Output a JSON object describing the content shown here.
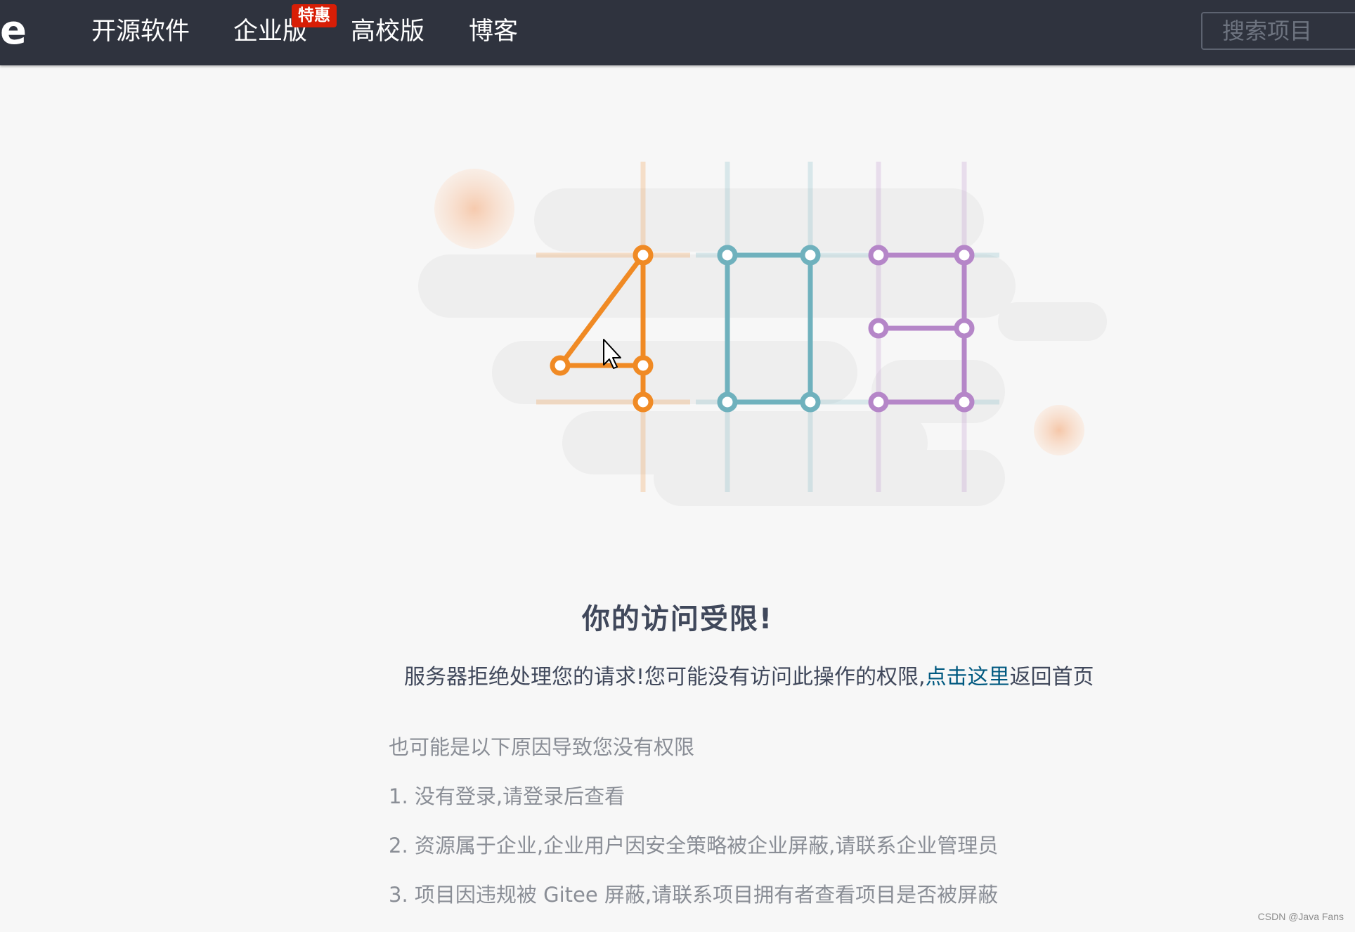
{
  "navbar": {
    "logo_letter": "e",
    "items": [
      {
        "label": "开源软件"
      },
      {
        "label": "企业版",
        "badge": "特惠"
      },
      {
        "label": "高校版"
      },
      {
        "label": "博客"
      }
    ],
    "search_placeholder": "搜索项目"
  },
  "illustration": {
    "digits": "403",
    "colors": {
      "four": "#f08a24",
      "zero": "#6fb1bd",
      "three": "#b586c8",
      "orb": "#f6c8a6"
    },
    "icons": [
      "mouse-cursor-icon"
    ]
  },
  "content": {
    "headline": "你的访问受限!",
    "desc_prefix": "服务器拒绝处理您的请求!您可能没有访问此操作的权限,",
    "desc_link": "点击这里",
    "desc_suffix": "返回首页",
    "reasons_title": "也可能是以下原因导致您没有权限",
    "reasons": [
      "1. 没有登录,请登录后查看",
      "2. 资源属于企业,企业用户因安全策略被企业屏蔽,请联系企业管理员",
      "3. 项目因违规被 Gitee 屏蔽,请联系项目拥有者查看项目是否被屏蔽"
    ]
  },
  "colors": {
    "navbar_bg": "#2f333e",
    "badge_bg": "#d81e06",
    "link": "#005980",
    "page_bg": "#f7f7f7"
  },
  "watermark": "CSDN @Java Fans"
}
